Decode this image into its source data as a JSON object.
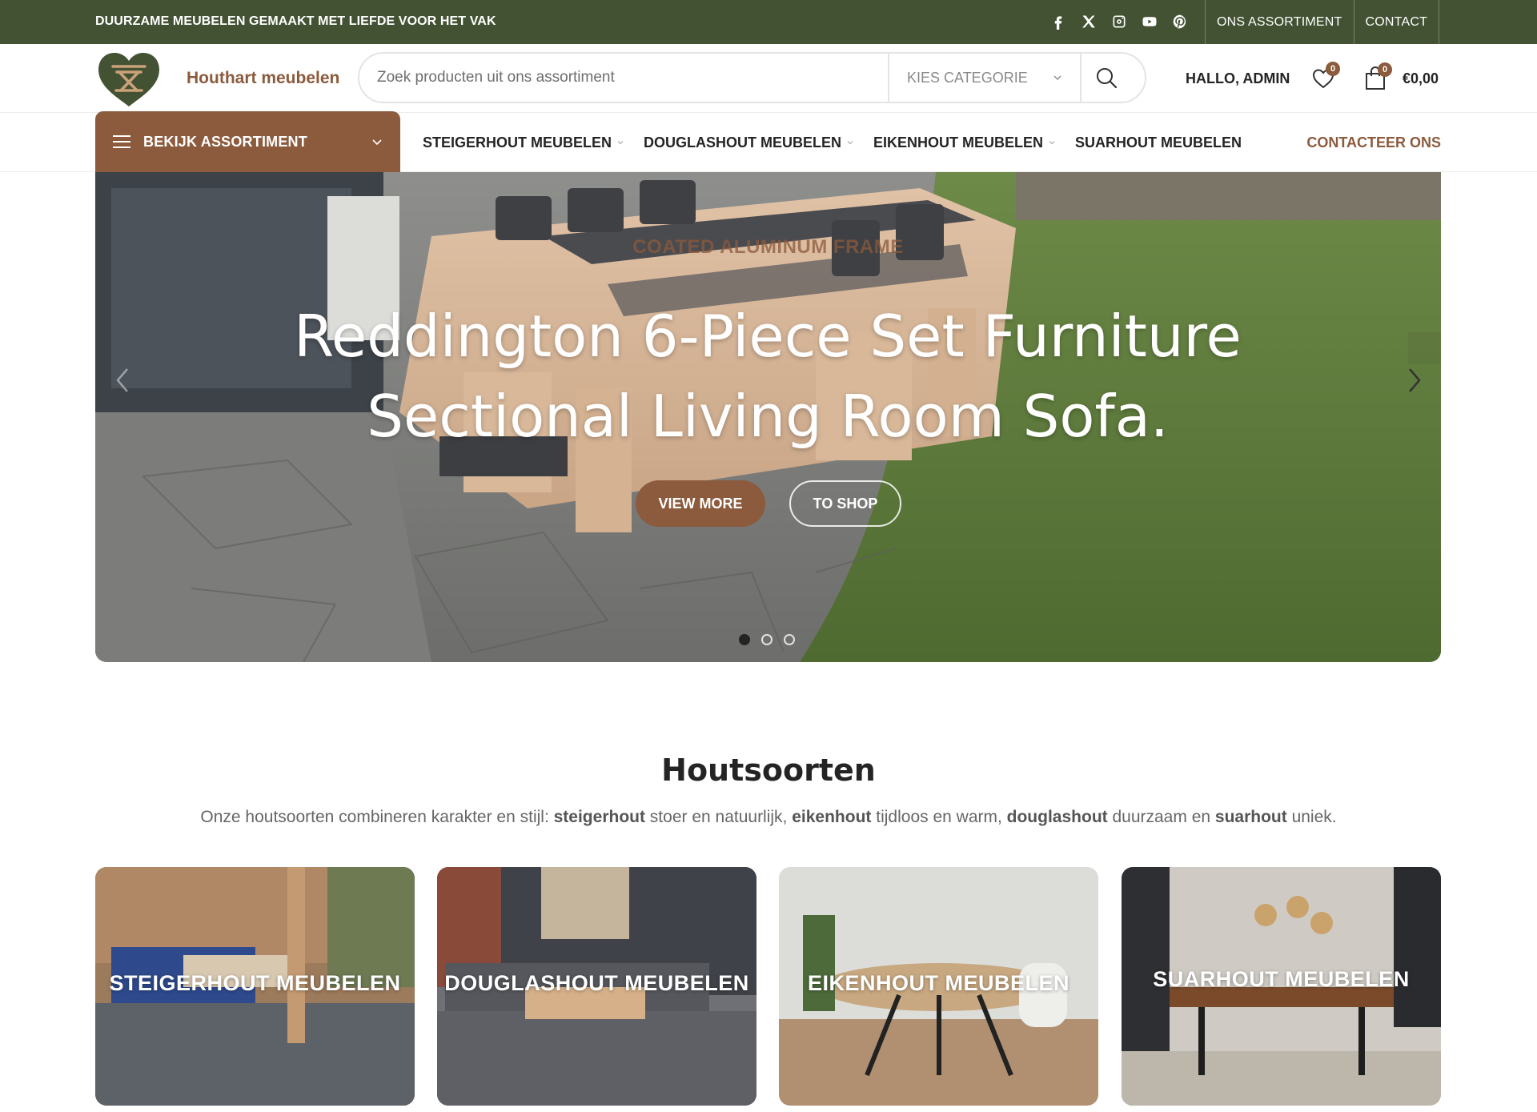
{
  "topbar": {
    "tagline": "DUURZAME MEUBELEN GEMAAKT MET LIEFDE VOOR HET VAK",
    "social_icons": [
      "facebook-icon",
      "x-icon",
      "instagram-icon",
      "youtube-icon",
      "pinterest-icon"
    ],
    "links": [
      "ONS ASSORTIMENT",
      "CONTACT"
    ]
  },
  "header": {
    "brand": "Houthart meubelen",
    "search_placeholder": "Zoek producten uit ons assortiment",
    "category_select": "KIES CATEGORIE",
    "greeting": "HALLO, ADMIN",
    "wishlist_count": "0",
    "cart_count": "0",
    "cart_total": "€0,00"
  },
  "nav": {
    "categories_button": "BEKIJK ASSORTIMENT",
    "items": [
      "STEIGERHOUT MEUBELEN",
      "DOUGLASHOUT MEUBELEN",
      "EIKENHOUT MEUBELEN",
      "SUARHOUT MEUBELEN"
    ],
    "contact": "CONTACTEER ONS"
  },
  "hero": {
    "eyebrow": "COATED ALUMINUM FRAME",
    "headline": "Reddington 6-Piece Set Furniture Sectional Living Room Sofa.",
    "button_primary": "VIEW MORE",
    "button_secondary": "TO SHOP",
    "slide_count": 3,
    "active_slide": 1
  },
  "section": {
    "title": "Houtsoorten",
    "desc_1": "Onze houtsoorten combineren karakter en stijl: ",
    "desc_b1": "steigerhout",
    "desc_2": " stoer en natuurlijk, ",
    "desc_b2": "eikenhout",
    "desc_3": " tijdloos en warm, ",
    "desc_b3": "douglashout",
    "desc_4": " duurzaam en ",
    "desc_b4": "suarhout",
    "desc_5": " uniek."
  },
  "cards": [
    {
      "title": "STEIGERHOUT MEUBELEN"
    },
    {
      "title": "DOUGLASHOUT MEUBELEN"
    },
    {
      "title": "EIKENHOUT MEUBELEN"
    },
    {
      "title": "SUARHOUT MEUBELEN"
    }
  ],
  "colors": {
    "green": "#435233",
    "brown": "#8c5a3c"
  }
}
